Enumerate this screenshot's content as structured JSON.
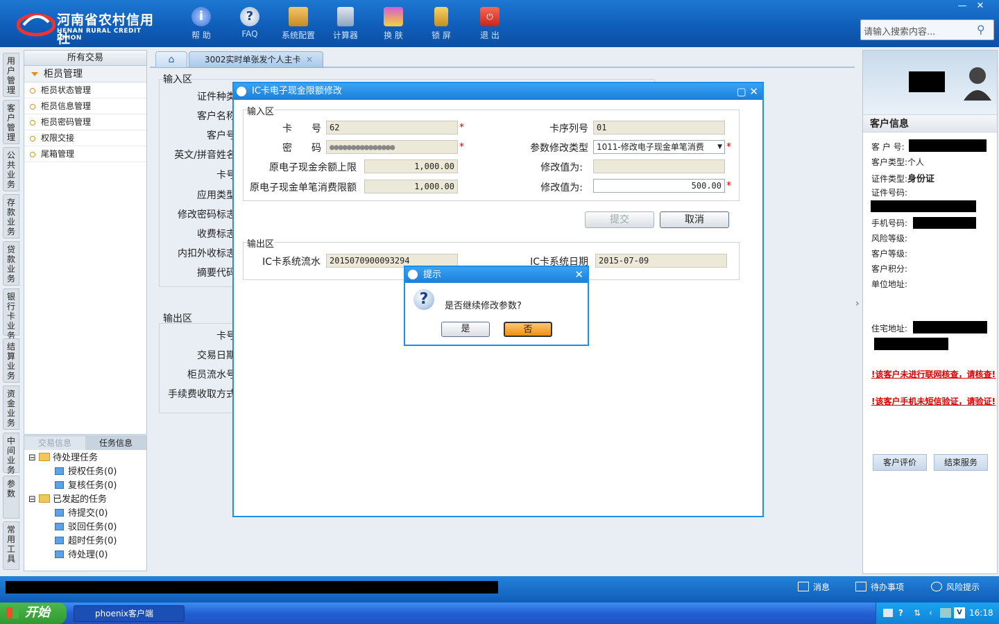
{
  "header": {
    "logo_cn": "河南省农村信用社",
    "logo_en": "HENAN RURAL CREDIT UNION",
    "tools": [
      "帮 助",
      "FAQ",
      "系统配置",
      "计算器",
      "换 肤",
      "锁 屏",
      "退 出"
    ],
    "search_placeholder": "请输入搜索内容...",
    "min": "—",
    "close": "✕"
  },
  "vtabs": [
    "用户管理",
    "客户管理",
    "公共业务",
    "存款业务",
    "贷款业务",
    "银行卡业务",
    "结算业务",
    "资金业务",
    "中间业务",
    "参数",
    "常用工具"
  ],
  "nav": {
    "header": "所有交易",
    "group": "柜员管理",
    "items": [
      "柜员状态管理",
      "柜员信息管理",
      "柜员密码管理",
      "权限交接",
      "尾箱管理"
    ]
  },
  "task": {
    "tabs": [
      "交易信息",
      "任务信息"
    ],
    "pending": "待处理任务",
    "pending_items": [
      "授权任务(0)",
      "复核任务(0)"
    ],
    "started": "已发起的任务",
    "started_items": [
      "待提交(0)",
      "驳回任务(0)",
      "超时任务(0)",
      "待处理(0)"
    ]
  },
  "tabs": {
    "current": "3002实时单张发个人主卡",
    "close": "✕"
  },
  "bg_form": {
    "input_section": "输入区",
    "input_labels": [
      "证件种类",
      "客户名称",
      "客户号",
      "英文/拼音姓名",
      "卡号",
      "应用类型",
      "修改密码标志",
      "收费标志",
      "内扣外收标志",
      "摘要代码"
    ],
    "output_section": "输出区",
    "output_labels": [
      "卡号",
      "交易日期",
      "柜员流水号",
      "手续费收取方式"
    ]
  },
  "dialog": {
    "title": "IC卡电子现金限额修改",
    "input_section": "输入区",
    "card_label": "卡　　号",
    "card_value": "62",
    "seq_label": "卡序列号",
    "seq_value": "01",
    "pwd_label": "密　　码",
    "pwd_value": "●●●●●●●●●●●●●●●",
    "param_label": "参数修改类型",
    "param_value": "1011-修改电子现金单笔消费",
    "balance_label": "原电子现金余额上限",
    "balance_value": "1,000.00",
    "modify1_label": "修改值为:",
    "modify1_value": "",
    "single_label": "原电子现金单笔消费限额",
    "single_value": "1,000.00",
    "modify2_label": "修改值为:",
    "modify2_value": "500.00",
    "submit": "提交",
    "cancel": "取消",
    "output_section": "输出区",
    "flow_label": "IC卡系统流水",
    "flow_value": "2015070900093294",
    "date_label": "IC卡系统日期",
    "date_value": "2015-07-09",
    "req": "*"
  },
  "prompt": {
    "title": "提示",
    "message": "是否继续修改参数?",
    "yes": "是",
    "no": "否"
  },
  "customer": {
    "section": "客户信息",
    "labels": {
      "id": "客 户 号:",
      "type": "客户类型:",
      "type_value": "个人",
      "cert_type": "证件类型:",
      "cert_type_value": "身份证",
      "cert_no": "证件号码:",
      "phone": "手机号码:",
      "risk": "风险等级:",
      "level": "客户等级:",
      "points": "客户积分:",
      "company": "单位地址:",
      "home": "住宅地址:"
    },
    "warn1": "!该客户未进行联网核查，请核查!",
    "warn2": "!该客户手机未短信验证，请验证!",
    "eval_btn": "客户评价",
    "end_btn": "结束服务"
  },
  "statusbar": {
    "msg": "消息",
    "todo": "待办事项",
    "risk": "风险提示"
  },
  "taskbar": {
    "start": "开始",
    "app": "phoenix客户端",
    "time": "16:18"
  },
  "colors": {
    "header_blue": "#0f5cb8",
    "dialog_border": "#1e8fe8",
    "required": "#dd0000",
    "warn": "#dd0000",
    "no_button": "#f6a22a"
  }
}
